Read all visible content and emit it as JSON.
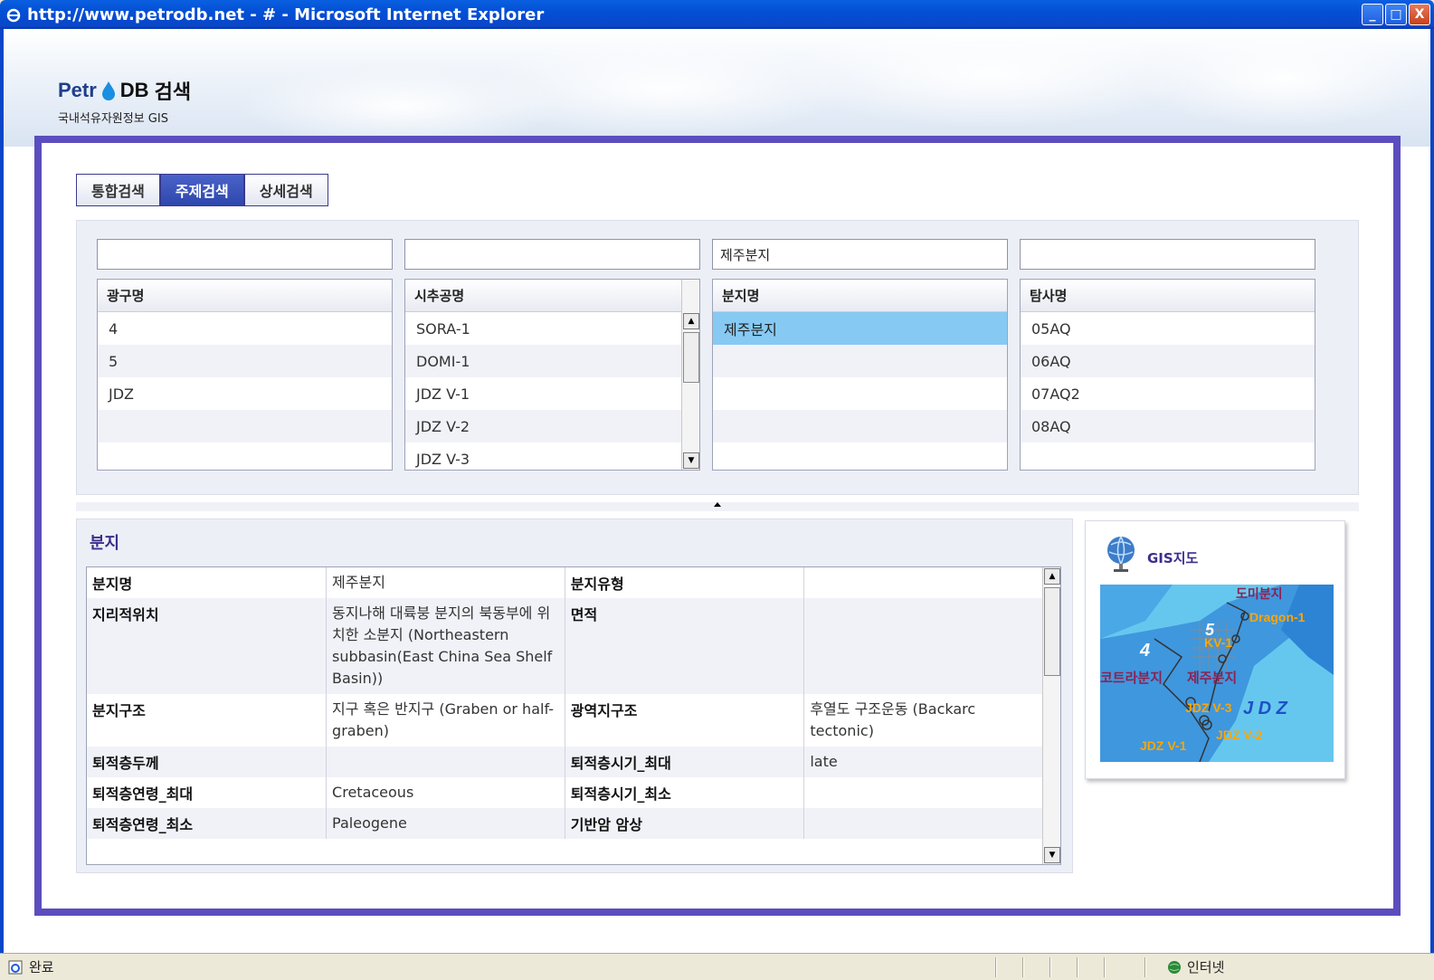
{
  "window": {
    "title": "http://www.petrodb.net - # - Microsoft Internet Explorer",
    "minimize": "_",
    "maximize": "□",
    "close": "X"
  },
  "logo": {
    "petr": "Petr",
    "db": "DB",
    "search": "검색",
    "subtitle": "국내석유자원정보 GIS"
  },
  "tabs": [
    {
      "label": "통합검색",
      "active": false
    },
    {
      "label": "주제검색",
      "active": true
    },
    {
      "label": "상세검색",
      "active": false
    }
  ],
  "search": {
    "columns": [
      {
        "input": "",
        "header": "광구명",
        "rows": [
          "4",
          "5",
          "JDZ",
          "",
          ""
        ]
      },
      {
        "input": "",
        "header": "시추공명",
        "rows": [
          "SORA-1",
          "DOMI-1",
          "JDZ V-1",
          "JDZ V-2",
          "JDZ V-3"
        ]
      },
      {
        "input": "제주분지",
        "header": "분지명",
        "rows": [
          "제주분지",
          "",
          "",
          "",
          ""
        ]
      },
      {
        "input": "",
        "header": "탐사명",
        "rows": [
          "05AQ",
          "06AQ",
          "07AQ2",
          "08AQ",
          ""
        ]
      }
    ]
  },
  "detail": {
    "title": "분지",
    "rows": [
      {
        "k1": "분지명",
        "v1": "제주분지",
        "k2": "분지유형",
        "v2": ""
      },
      {
        "k1": "지리적위치",
        "v1": "동지나해 대륙붕 분지의 북동부에 위치한 소분지 (Northeastern subbasin(East China Sea Shelf Basin))",
        "k2": "면적",
        "v2": ""
      },
      {
        "k1": "분지구조",
        "v1": "지구 혹은 반지구 (Graben or half-graben)",
        "k2": "광역지구조",
        "v2": "후열도 구조운동 (Backarc tectonic)"
      },
      {
        "k1": "퇴적층두께",
        "v1": "",
        "k2": "퇴적층시기_최대",
        "v2": "late"
      },
      {
        "k1": "퇴적층연령_최대",
        "v1": "Cretaceous",
        "k2": "퇴적층시기_최소",
        "v2": ""
      },
      {
        "k1": "퇴적층연령_최소",
        "v1": "Paleogene",
        "k2": "기반암 암상",
        "v2": ""
      }
    ]
  },
  "gis": {
    "title": "GIS지도",
    "labels": {
      "dragon": "Dragon-1",
      "kv": "KV-1",
      "n4": "4",
      "n5": "5",
      "jdz": "J D Z",
      "jdzv1": "JDZ V-1",
      "jdzv2": "JDZ V-2",
      "jdzv3": "JDZ V-3",
      "basin_top": "도미분지",
      "basin_mid": "코트라분지",
      "basin_jeju": "제주분지"
    }
  },
  "status": {
    "left": "완료",
    "zone": "인터넷"
  },
  "colors": {
    "panel_border": "#5C4DBF",
    "titlebar": "#0A46C8",
    "selected_row": "#86CAF4",
    "tab_active": "#2E47AD"
  }
}
